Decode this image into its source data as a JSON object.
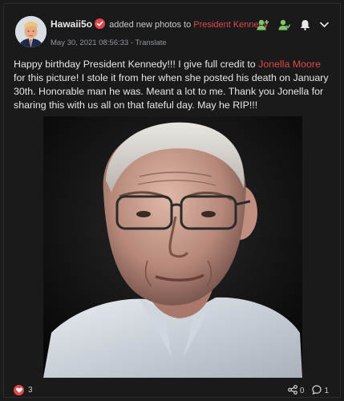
{
  "post": {
    "author": "Hawaii5o",
    "action_text": "added new photos to",
    "group": "President Kennedy",
    "timestamp": "May 30, 2021 08:56:33",
    "separator": " - ",
    "translate": "Translate",
    "text_part1": "Happy birthday President Kennedy!!! I give full credit to ",
    "mention": "Jonella Moore",
    "text_part2": " for this picture! I stole it from her when she posted his death on January 30th. Honorable man he was. Meant a lot to me. Thank you Jonella for sharing this with us all on that fateful day. May he RIP!!!"
  },
  "header_icons": [
    "add-friend-icon",
    "follow-user-icon",
    "bell-icon",
    "chevron-down-icon"
  ],
  "stats": {
    "likes": "3",
    "shares": "0",
    "comments": "1"
  },
  "colors": {
    "accent": "#e0474c",
    "verified": "#e0474c",
    "green_icon": "#7fc56a"
  }
}
